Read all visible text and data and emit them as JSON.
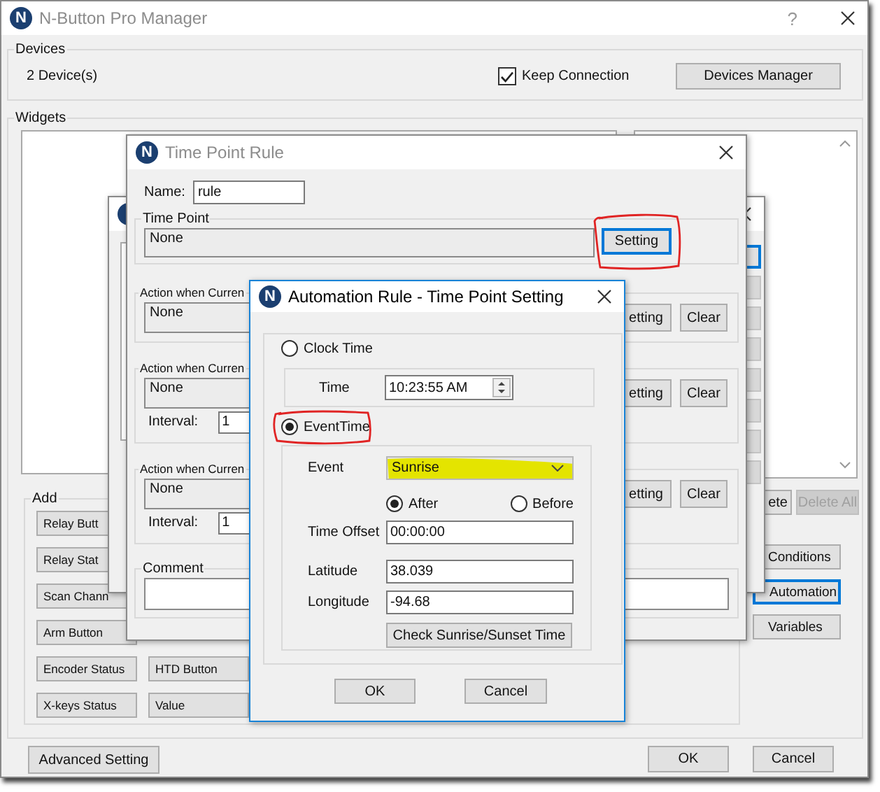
{
  "main_window": {
    "icon_letter": "N",
    "title": "N-Button Pro Manager",
    "active": false,
    "help": "?",
    "devices": {
      "label": "Devices",
      "count": "2 Device(s)",
      "keep_connection": {
        "label": "Keep Connection",
        "checked": true
      },
      "manager_button": "Devices Manager"
    },
    "widgets": {
      "label": "Widgets",
      "list_buttons": [
        {
          "label": "ete",
          "disabled": false
        },
        {
          "label": "Delete All",
          "disabled": true
        }
      ],
      "add": {
        "label": "Add",
        "rows": [
          [
            "Relay Butt"
          ],
          [
            "Relay Stat"
          ],
          [
            "Scan Chann"
          ],
          [
            "Arm Button"
          ],
          [
            "Encoder Status",
            "HTD Button"
          ],
          [
            "X-keys Status",
            "Value"
          ]
        ]
      },
      "side_buttons": [
        {
          "label": "Conditions",
          "focused": false
        },
        {
          "label": "Automation",
          "focused": true
        },
        {
          "label": "Variables",
          "focused": false
        }
      ]
    },
    "footer": {
      "advanced_button": "Advanced Setting",
      "ok_button": "OK",
      "cancel_button": "Cancel"
    }
  },
  "time_point_rule": {
    "icon_letter": "N",
    "title": "Time Point Rule",
    "active": false,
    "name": {
      "label": "Name:",
      "value": "rule"
    },
    "time_point": {
      "label": "Time Point",
      "value": "None",
      "button": {
        "label": "Setting",
        "focused": true
      }
    },
    "actions": [
      {
        "label": "Action when Curren",
        "value": "None",
        "setting_button": "etting",
        "clear_button": "Clear"
      },
      {
        "label": "Action when Curren",
        "value": "None",
        "setting_button": "etting",
        "clear_button": "Clear",
        "interval": {
          "label": "Interval:",
          "value": "1"
        }
      },
      {
        "label": "Action when Curren",
        "value": "None",
        "setting_button": "etting",
        "clear_button": "Clear",
        "interval": {
          "label": "Interval:",
          "value": "1"
        }
      }
    ],
    "comment": {
      "label": "Comment"
    }
  },
  "automation_rule": {
    "icon_letter": "N",
    "title": "Automation Rule - Time Point Setting",
    "active": true,
    "modes": [
      {
        "label": "Clock Time",
        "selected": false
      },
      {
        "label": "EventTime",
        "selected": true
      }
    ],
    "time": {
      "label": "Time",
      "value": "10:23:55 AM"
    },
    "event": {
      "label": "Event",
      "value": "Sunrise"
    },
    "offset_direction": [
      {
        "label": "After",
        "selected": true
      },
      {
        "label": "Before",
        "selected": false
      }
    ],
    "fields": [
      {
        "label": "Time Offset",
        "value": "00:00:00"
      },
      {
        "label": "Latitude",
        "value": "38.039"
      },
      {
        "label": "Longitude",
        "value": "-94.68"
      }
    ],
    "check_button": "Check Sunrise/Sunset Time",
    "ok_button": "OK",
    "cancel_button": "Cancel"
  }
}
